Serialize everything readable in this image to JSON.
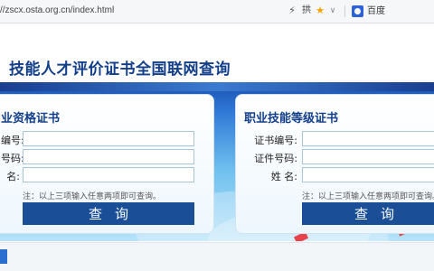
{
  "browser": {
    "address": "//zscx.osta.org.cn/index.html",
    "bolt_glyph": "⚡",
    "reader_glyph": "拱",
    "star_glyph": "★",
    "chevron_glyph": "∨",
    "search_engine": "百度"
  },
  "header": {
    "title": "技能人才评价证书全国联网查询"
  },
  "left_card": {
    "title": "业资格证书",
    "field1_label": "编号:",
    "field2_label": "号码:",
    "field3_label": "名:",
    "field1_value": "",
    "field2_value": "",
    "field3_value": "",
    "note": "注：以上三项输入任意两项即可查询。",
    "query_label": "查询"
  },
  "right_card": {
    "title": "职业技能等级证书",
    "field1_label": "证书编号:",
    "field2_label": "证件号码:",
    "field3_label": "姓 名:",
    "field1_value": "",
    "field2_value": "",
    "field3_value": "",
    "note": "注：以上三项输入任意两项即可查询。",
    "query_label": "查询"
  },
  "colors": {
    "title_blue": "#123e8a",
    "button_blue": "#1a4f98",
    "star": "#f5a300"
  }
}
